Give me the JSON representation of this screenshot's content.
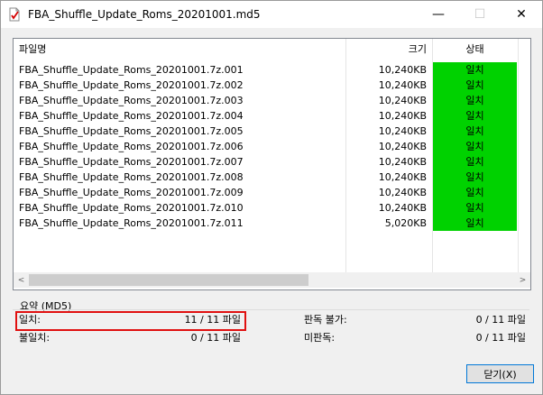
{
  "window": {
    "title": "FBA_Shuffle_Update_Roms_20201001.md5",
    "minimize_glyph": "—",
    "maximize_glyph": "☐",
    "close_glyph": "✕"
  },
  "list": {
    "columns": {
      "name": "파일명",
      "size": "크기",
      "status": "상태"
    },
    "rows": [
      {
        "name": "FBA_Shuffle_Update_Roms_20201001.7z.001",
        "size": "10,240KB",
        "status": "일치"
      },
      {
        "name": "FBA_Shuffle_Update_Roms_20201001.7z.002",
        "size": "10,240KB",
        "status": "일치"
      },
      {
        "name": "FBA_Shuffle_Update_Roms_20201001.7z.003",
        "size": "10,240KB",
        "status": "일치"
      },
      {
        "name": "FBA_Shuffle_Update_Roms_20201001.7z.004",
        "size": "10,240KB",
        "status": "일치"
      },
      {
        "name": "FBA_Shuffle_Update_Roms_20201001.7z.005",
        "size": "10,240KB",
        "status": "일치"
      },
      {
        "name": "FBA_Shuffle_Update_Roms_20201001.7z.006",
        "size": "10,240KB",
        "status": "일치"
      },
      {
        "name": "FBA_Shuffle_Update_Roms_20201001.7z.007",
        "size": "10,240KB",
        "status": "일치"
      },
      {
        "name": "FBA_Shuffle_Update_Roms_20201001.7z.008",
        "size": "10,240KB",
        "status": "일치"
      },
      {
        "name": "FBA_Shuffle_Update_Roms_20201001.7z.009",
        "size": "10,240KB",
        "status": "일치"
      },
      {
        "name": "FBA_Shuffle_Update_Roms_20201001.7z.010",
        "size": "10,240KB",
        "status": "일치"
      },
      {
        "name": "FBA_Shuffle_Update_Roms_20201001.7z.011",
        "size": "5,020KB",
        "status": "일치"
      }
    ],
    "scroll_left_glyph": "<",
    "scroll_right_glyph": ">"
  },
  "summary": {
    "title": "요약 (MD5)",
    "match_label": "일치:",
    "match_value": "11 / 11 파일",
    "mismatch_label": "불일치:",
    "mismatch_value": "0 / 11 파일",
    "undetermined_label": "판독 불가:",
    "undetermined_value": "0 / 11 파일",
    "unread_label": "미판독:",
    "unread_value": "0 / 11 파일"
  },
  "buttons": {
    "close": "닫기(X)"
  },
  "colors": {
    "match_bg": "#00d200",
    "highlight": "#e01010",
    "focus_border": "#0078d7"
  }
}
